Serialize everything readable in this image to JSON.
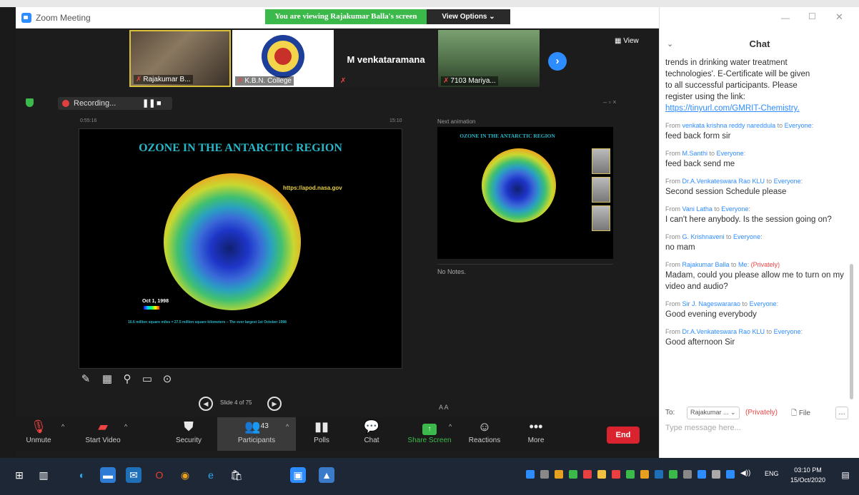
{
  "window": {
    "title": "Zoom Meeting",
    "viewing_banner": "You are viewing Rajakumar Balla's screen",
    "view_options": "View Options ⌄",
    "view_btn": "View"
  },
  "participants_strip": [
    {
      "name": "Rajakumar B..."
    },
    {
      "name": "K.B.N. College"
    },
    {
      "name": "M venkataramana"
    },
    {
      "name": "7103 Mariya..."
    }
  ],
  "share": {
    "recording": "Recording...",
    "elapsed": "0:55:16",
    "clock": "15:10"
  },
  "slide": {
    "title": "OZONE IN THE ANTARCTIC REGION",
    "source": "https://apod.nasa.gov",
    "date": "Oct 1, 1998",
    "caption": "10.6 million square miles = 27.5 million square kilometers – The ever largest 1st October 1998",
    "counter": "Slide 4 of 75"
  },
  "next_panel": {
    "label": "Next animation",
    "title": "OZONE IN THE ANTARCTIC REGION",
    "notes": "No Notes."
  },
  "controls": {
    "unmute": "Unmute",
    "start_video": "Start Video",
    "security": "Security",
    "participants": "Participants",
    "participants_count": "43",
    "polls": "Polls",
    "chat": "Chat",
    "share_screen": "Share Screen",
    "reactions": "Reactions",
    "more": "More",
    "end": "End"
  },
  "chat": {
    "title": "Chat",
    "intro_lines": [
      "trends in drinking water treatment",
      "technologies'. E-Certificate will be given",
      "to all successful participants. Please",
      "register using the link:"
    ],
    "intro_link": "https://tinyurl.com/GMRIT-Chemistry.",
    "messages": [
      {
        "from": "venkata krishna reddy nareddula",
        "to": "Everyone",
        "text": "feed back form sir"
      },
      {
        "from": "M.Santhi",
        "to": "Everyone",
        "text": "feed back send me"
      },
      {
        "from": "Dr.A.Venkateswara Rao KLU",
        "to": "Everyone",
        "text": "Second session Schedule please"
      },
      {
        "from": "Vani Latha",
        "to": "Everyone",
        "text": "I can't here anybody. Is the session going on?"
      },
      {
        "from": "G. Krishnaveni",
        "to": "Everyone",
        "text": "no mam"
      },
      {
        "from": "Rajakumar Balla",
        "to": "Me",
        "private": "(Privately)",
        "text": "Madam, could you please allow me to turn on my video and audio?"
      },
      {
        "from": "Sir J. Nageswararao",
        "to": "Everyone",
        "text": "Good evening everybody"
      },
      {
        "from": "Dr.A.Venkateswara Rao KLU",
        "to": "Everyone",
        "text": "Good afternoon Sir"
      }
    ],
    "to_label": "To:",
    "to_value": "Rajakumar ... ⌄",
    "to_private": "(Privately)",
    "file": "File",
    "placeholder": "Type message here..."
  },
  "taskbar": {
    "time": "03:10 PM",
    "date": "15/Oct/2020",
    "lang": "ENG"
  },
  "colors": {
    "zoom_blue": "#2d8cff",
    "share_green": "#3cb94b",
    "end_red": "#d9232e"
  }
}
